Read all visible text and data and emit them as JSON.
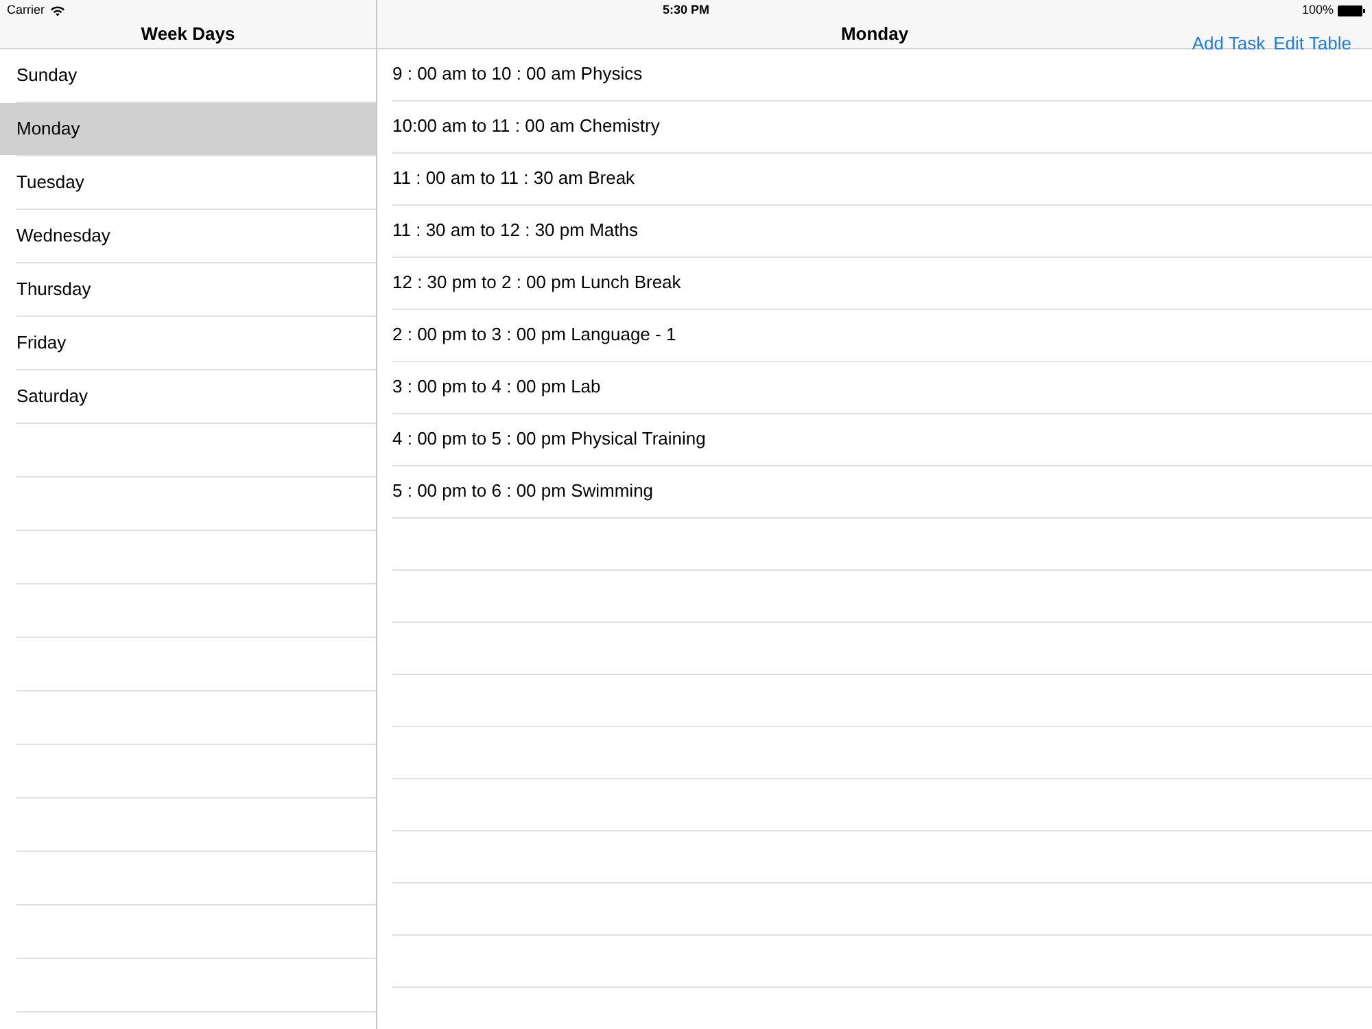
{
  "status_bar": {
    "carrier": "Carrier",
    "time": "5:30 PM",
    "battery": "100%"
  },
  "sidebar": {
    "title": "Week Days",
    "items": [
      {
        "label": "Sunday",
        "selected": false
      },
      {
        "label": "Monday",
        "selected": true
      },
      {
        "label": "Tuesday",
        "selected": false
      },
      {
        "label": "Wednesday",
        "selected": false
      },
      {
        "label": "Thursday",
        "selected": false
      },
      {
        "label": "Friday",
        "selected": false
      },
      {
        "label": "Saturday",
        "selected": false
      }
    ]
  },
  "detail": {
    "title": "Monday",
    "actions": [
      "Add Task",
      "Edit Table"
    ],
    "rows": [
      "9 : 00 am to 10 : 00 am Physics",
      "10:00 am to 11 : 00 am Chemistry",
      "11 : 00 am to 11 : 30 am Break",
      "11 : 30 am to 12 : 30 pm Maths",
      "12 : 30 pm to 2 : 00 pm Lunch Break",
      "2 : 00 pm to 3 : 00 pm Language - 1",
      "3 : 00 pm to 4 : 00 pm Lab",
      "4 : 00 pm to 5 : 00 pm Physical Training",
      "5 : 00 pm to 6 : 00 pm Swimming"
    ]
  }
}
